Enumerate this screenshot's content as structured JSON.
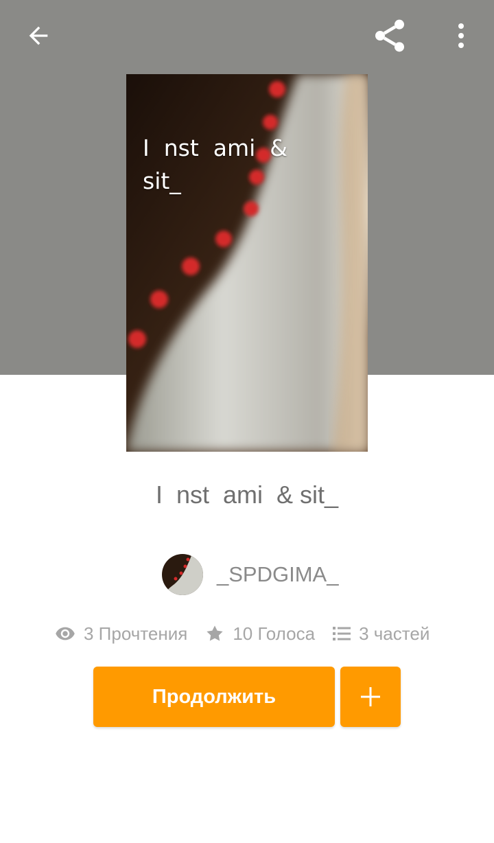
{
  "toolbar": {
    "back_icon": "arrow-left-icon",
    "share_icon": "share-icon",
    "more_icon": "more-vertical-icon"
  },
  "cover": {
    "text": "I  nst  ami  &\nsit_"
  },
  "story": {
    "title": "I  nst  ami  & sit_"
  },
  "author": {
    "name": "_SPDGIMA_"
  },
  "stats": {
    "reads": "3 Прочтения",
    "votes": "10 Голоса",
    "parts": "3 частей"
  },
  "actions": {
    "continue_label": "Продолжить",
    "add_icon": "plus-icon"
  },
  "colors": {
    "header": "#8a8a87",
    "accent": "#ff9a00",
    "stat_text": "#a6a6a6",
    "title_text": "#6f6f6f"
  }
}
